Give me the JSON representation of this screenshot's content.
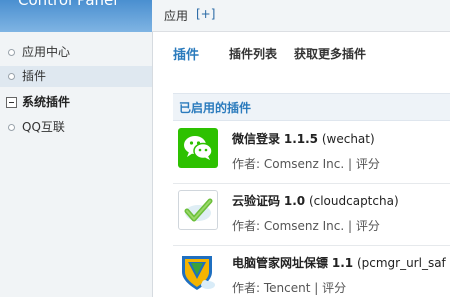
{
  "header": {
    "logo_text": "Control Panel",
    "app_label": "应用",
    "add_label": "[+]"
  },
  "sidebar": {
    "items": [
      {
        "label": "应用中心",
        "active": false
      },
      {
        "label": "插件",
        "active": true
      }
    ],
    "group": {
      "label": "系统插件"
    },
    "group_items": [
      {
        "label": "QQ互联"
      }
    ]
  },
  "tabs": [
    {
      "label": "插件",
      "active": true
    },
    {
      "label": "插件列表"
    },
    {
      "label": "获取更多插件"
    }
  ],
  "section": {
    "title": "已启用的插件"
  },
  "plugins": [
    {
      "name": "微信登录",
      "version": "1.1.5",
      "id": "(wechat)",
      "author_prefix": "作者: ",
      "author": "Comsenz Inc.",
      "separator": " | ",
      "rate": "评分",
      "icon": "wechat-icon"
    },
    {
      "name": "云验证码",
      "version": "1.0",
      "id": "(cloudcaptcha)",
      "author_prefix": "作者: ",
      "author": "Comsenz Inc.",
      "separator": " | ",
      "rate": "评分",
      "icon": "cloudcaptcha-icon"
    },
    {
      "name": "电脑管家网址保镖",
      "version": "1.1",
      "id": "(pcmgr_url_saf",
      "author_prefix": "作者: ",
      "author": "Tencent",
      "separator": " | ",
      "rate": "评分",
      "icon": "pcmgr-shield-icon"
    }
  ],
  "colors": {
    "accent": "#2b7bbd",
    "wechat_green": "#2dc100",
    "sidebar_bg": "#f1f4f6",
    "header_blue": "#4a8fd0"
  }
}
